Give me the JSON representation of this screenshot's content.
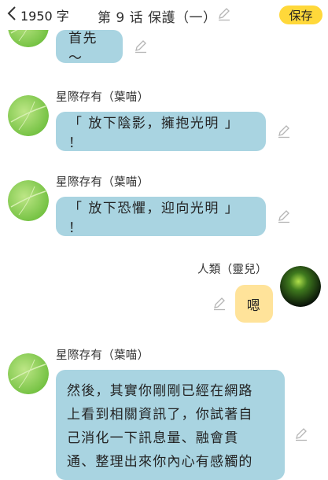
{
  "header": {
    "word_count": "1950 字",
    "chapter_title": "第 9 话  保護（一）",
    "save_label": "保存",
    "accent_color": "#ffd83a"
  },
  "messages": [
    {
      "sender": "",
      "text": "首先～"
    },
    {
      "sender": "星際存有（葉喵）",
      "text": "「 放下陰影，擁抱光明 」 ！"
    },
    {
      "sender": "星際存有（葉喵）",
      "text": "「 放下恐懼，迎向光明 」 ！"
    },
    {
      "sender": "人類（靈兒）",
      "text": "嗯"
    },
    {
      "sender": "星際存有（葉喵）",
      "lines": [
        "然後，其實你剛剛已經在網路",
        "上看到相關資訊了，你試著自",
        "己消化一下訊息量、融會貫",
        "通、整理出來你內心有感觸的"
      ]
    }
  ],
  "colors": {
    "other_bubble": "#a9d4e1",
    "my_bubble": "#ffe39a"
  }
}
